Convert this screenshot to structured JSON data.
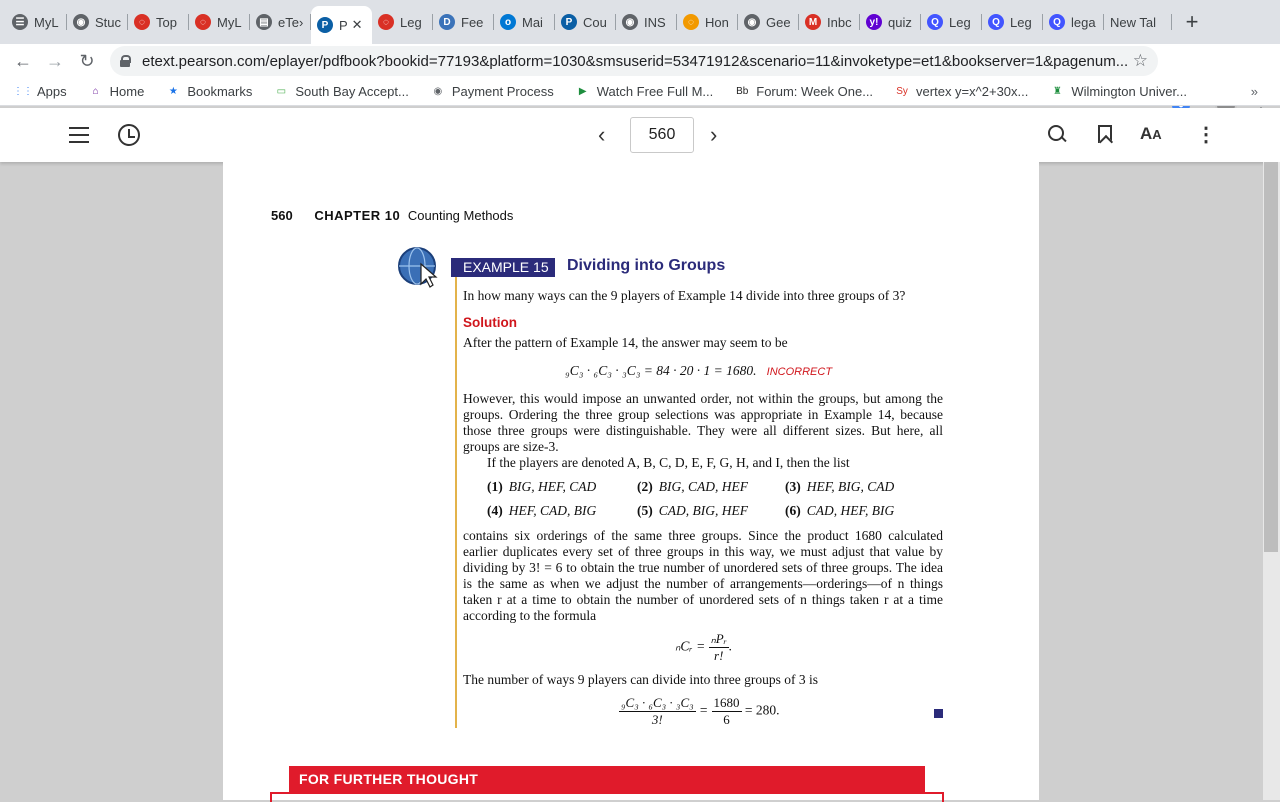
{
  "browser": {
    "tabs": [
      {
        "title": "MyL",
        "icon": "doc-icon",
        "color": "#5f6368"
      },
      {
        "title": "Stuc",
        "icon": "globe-icon",
        "color": "#5f6368"
      },
      {
        "title": "Top",
        "icon": "ring-icon",
        "color": "#d93025"
      },
      {
        "title": "MyL",
        "icon": "ring-icon",
        "color": "#d93025"
      },
      {
        "title": "eTe›",
        "icon": "book-icon",
        "color": "#5f6368"
      },
      {
        "title": "P",
        "icon": "pearson-icon",
        "color": "#0b5fa5",
        "active": true
      },
      {
        "title": "Leg",
        "icon": "ring-icon",
        "color": "#d93025"
      },
      {
        "title": "Fee",
        "icon": "d2l-icon",
        "color": "#3b73b9"
      },
      {
        "title": "Mai",
        "icon": "outlook-icon",
        "color": "#0078d4"
      },
      {
        "title": "Cou",
        "icon": "pearson-icon",
        "color": "#0b5fa5"
      },
      {
        "title": "INS",
        "icon": "globe-icon",
        "color": "#5f6368"
      },
      {
        "title": "Hon",
        "icon": "ring-icon",
        "color": "#f29900"
      },
      {
        "title": "Gee",
        "icon": "globe-icon",
        "color": "#5f6368"
      },
      {
        "title": "Inbc",
        "icon": "gmail-icon",
        "color": "#d93025"
      },
      {
        "title": "quiz",
        "icon": "yahoo-icon",
        "color": "#6001d2"
      },
      {
        "title": "Leg",
        "icon": "q-icon",
        "color": "#4255ff"
      },
      {
        "title": "Leg",
        "icon": "q-icon",
        "color": "#4255ff"
      },
      {
        "title": "lega",
        "icon": "q-icon",
        "color": "#4255ff"
      },
      {
        "title": "New Tal",
        "icon": "",
        "color": ""
      }
    ],
    "active_tab_close": "✕",
    "new_tab": "+",
    "url": "etext.pearson.com/eplayer/pdfbook?bookid=77193&platform=1030&smsuserid=53471912&scenario=11&invoketype=et1&bookserver=1&pagenum...",
    "bookmarks": [
      {
        "label": "Apps",
        "icon": "apps-icon"
      },
      {
        "label": "Home",
        "icon": "home-icon"
      },
      {
        "label": "Bookmarks",
        "icon": "star-icon"
      },
      {
        "label": "South Bay Accept...",
        "icon": "page-icon"
      },
      {
        "label": "Payment Process",
        "icon": "globe-icon"
      },
      {
        "label": "Watch Free Full M...",
        "icon": "play-icon"
      },
      {
        "label": "Forum: Week One...",
        "icon": "bb-icon"
      },
      {
        "label": "vertex y=x^2+30x...",
        "icon": "sy-icon"
      },
      {
        "label": "Wilmington Univer...",
        "icon": "tower-icon"
      }
    ],
    "bookmarks_more": "»"
  },
  "reader": {
    "page_number": "560"
  },
  "page": {
    "running_head_number": "560",
    "chapter_label": "CHAPTER 10",
    "chapter_title": "Counting Methods",
    "example_label": "EXAMPLE 15",
    "example_title": "Dividing into Groups",
    "question": "In how many ways can the 9 players of Example 14 divide into three groups of 3?",
    "solution_label": "Solution",
    "p1": "After the pattern of Example 14, the answer may seem to be",
    "eq1": "₉C₃ · ₆C₃ · ₃C₃ = 84 · 20 · 1 = 1680.",
    "incorrect": "INCORRECT",
    "p2": "However, this would impose an unwanted order, not within the groups, but among the groups. Ordering the three group selections was appropriate in Example 14, because those three groups were distinguishable. They were all different sizes. But here, all groups are size-3.",
    "p3": "If the players are denoted A, B, C, D, E, F, G, H, and I, then the list",
    "list": [
      {
        "num": "(1)",
        "text": "BIG, HEF, CAD"
      },
      {
        "num": "(2)",
        "text": "BIG, CAD, HEF"
      },
      {
        "num": "(3)",
        "text": "HEF, BIG, CAD"
      },
      {
        "num": "(4)",
        "text": "HEF, CAD, BIG"
      },
      {
        "num": "(5)",
        "text": "CAD, BIG, HEF"
      },
      {
        "num": "(6)",
        "text": "CAD, HEF, BIG"
      }
    ],
    "p4": "contains six orderings of the same three groups. Since the product 1680 calculated earlier duplicates every set of three groups in this way, we must adjust that value by dividing by 3! = 6 to obtain the true number of unordered sets of three groups. The idea is the same as when we adjust the number of arrangements—orderings—of n things taken r at a time to obtain the number of unordered sets of n things taken r at a time according to the formula",
    "formula_lhs": "ₙCᵣ =",
    "formula_num": "ₙPᵣ",
    "formula_den": "r!",
    "formula_end": ".",
    "p5": "The number of ways 9 players can divide into three groups of 3 is",
    "final_num_left": "₉C₃ · ₆C₃ · ₃C₃",
    "final_den_left": "3!",
    "final_eq": "=",
    "final_num_right": "1680",
    "final_den_right": "6",
    "final_result": "= 280.",
    "further_thought": "FOR FURTHER THOUGHT"
  },
  "colors": {
    "accent_blue": "#2b2b7a",
    "solution_red": "#d0161c",
    "bar_gold": "#e3b34b"
  }
}
